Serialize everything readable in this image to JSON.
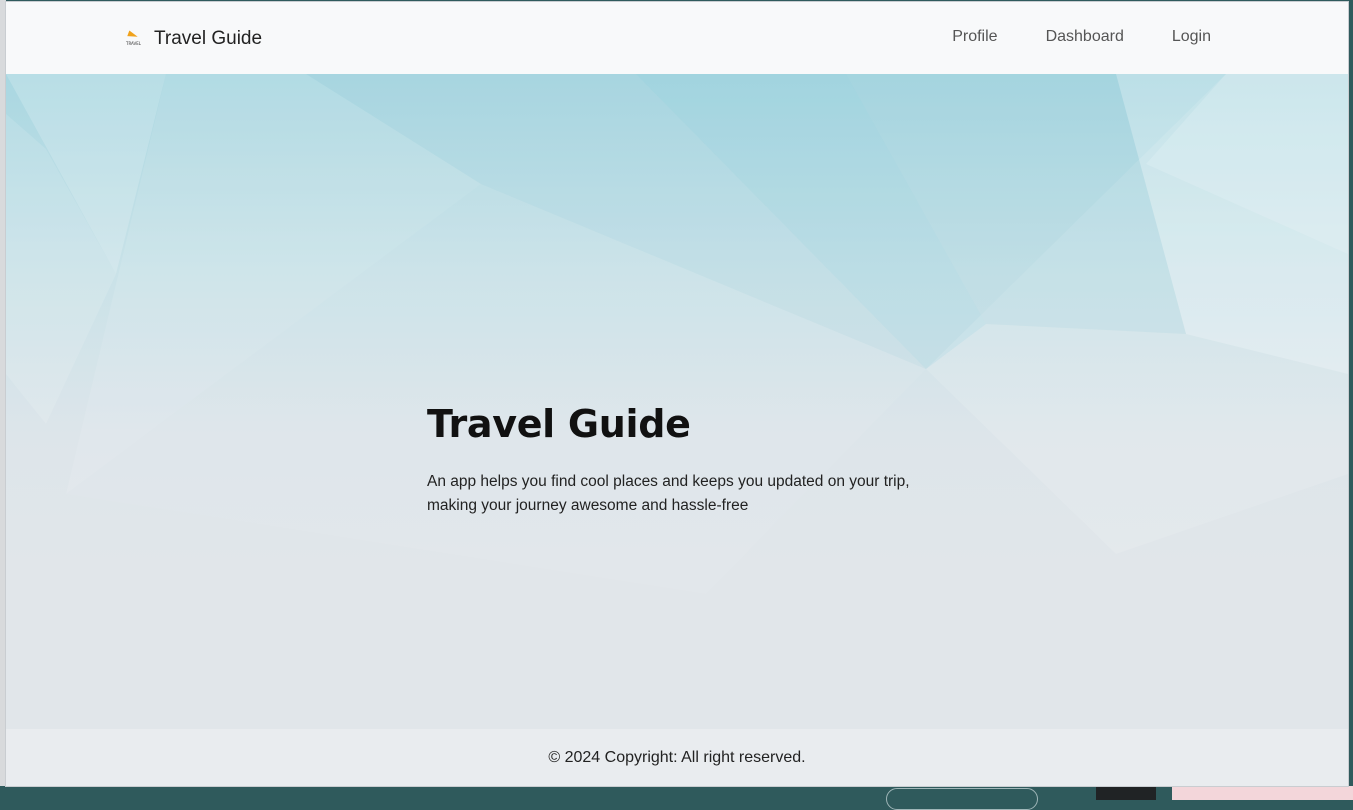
{
  "navbar": {
    "brand": {
      "logo_icon": "travel-plane-logo",
      "logo_text": "TRAVEL",
      "title": "Travel Guide"
    },
    "links": [
      {
        "label": "Profile"
      },
      {
        "label": "Dashboard"
      },
      {
        "label": "Login"
      }
    ]
  },
  "hero": {
    "title": "Travel Guide",
    "description": "An app helps you find cool places and keeps you updated on your trip, making your journey awesome and hassle-free"
  },
  "footer": {
    "copyright": "© 2024 Copyright: All right reserved."
  },
  "colors": {
    "navbar_bg": "#f8f9fa",
    "hero_top": "#a9d7e1",
    "hero_bottom": "#e1e6ea",
    "footer_bg": "#e9ecef",
    "logo_accent": "#f0a21b"
  }
}
